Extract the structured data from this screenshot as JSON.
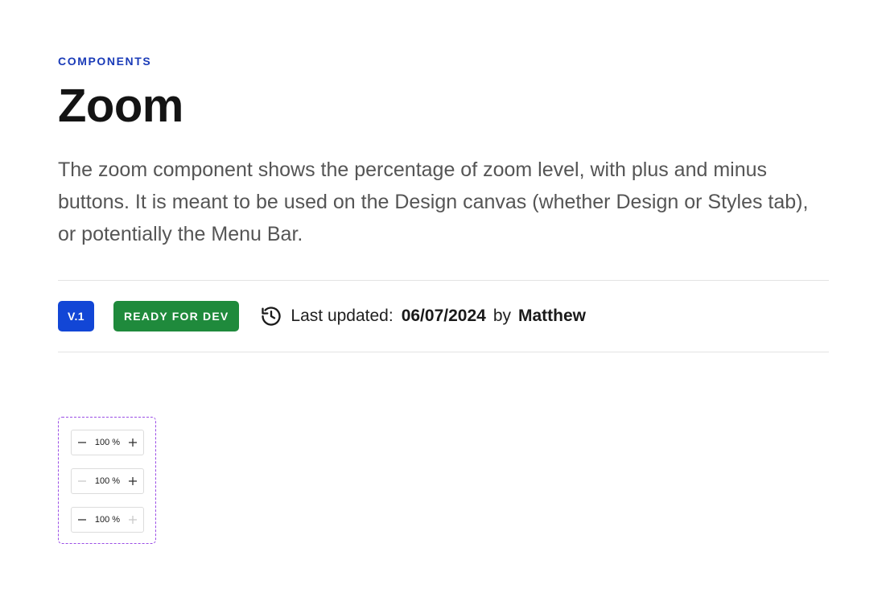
{
  "header": {
    "eyebrow": "COMPONENTS",
    "title": "Zoom",
    "description": "The zoom component shows the percentage of zoom level, with plus and minus buttons. It is meant to be used on the Design canvas (whether Design or Styles tab), or potentially the Menu Bar."
  },
  "meta": {
    "version": "V.1",
    "status": "READY FOR DEV",
    "status_color": "#1f8a3c",
    "version_color": "#1246d6",
    "history_icon": "history-icon",
    "updated_label": "Last updated:",
    "updated_date": "06/07/2024",
    "by_label": "by",
    "author": "Matthew"
  },
  "zoom_variants": [
    {
      "value": "100 %",
      "minus_enabled": true,
      "plus_enabled": true
    },
    {
      "value": "100 %",
      "minus_enabled": false,
      "plus_enabled": true
    },
    {
      "value": "100 %",
      "minus_enabled": true,
      "plus_enabled": false
    }
  ],
  "colors": {
    "accent": "#1a3bb8",
    "frame_border": "#9b4ee6",
    "enabled_icon": "#333333",
    "disabled_icon": "#c8c8c8"
  }
}
